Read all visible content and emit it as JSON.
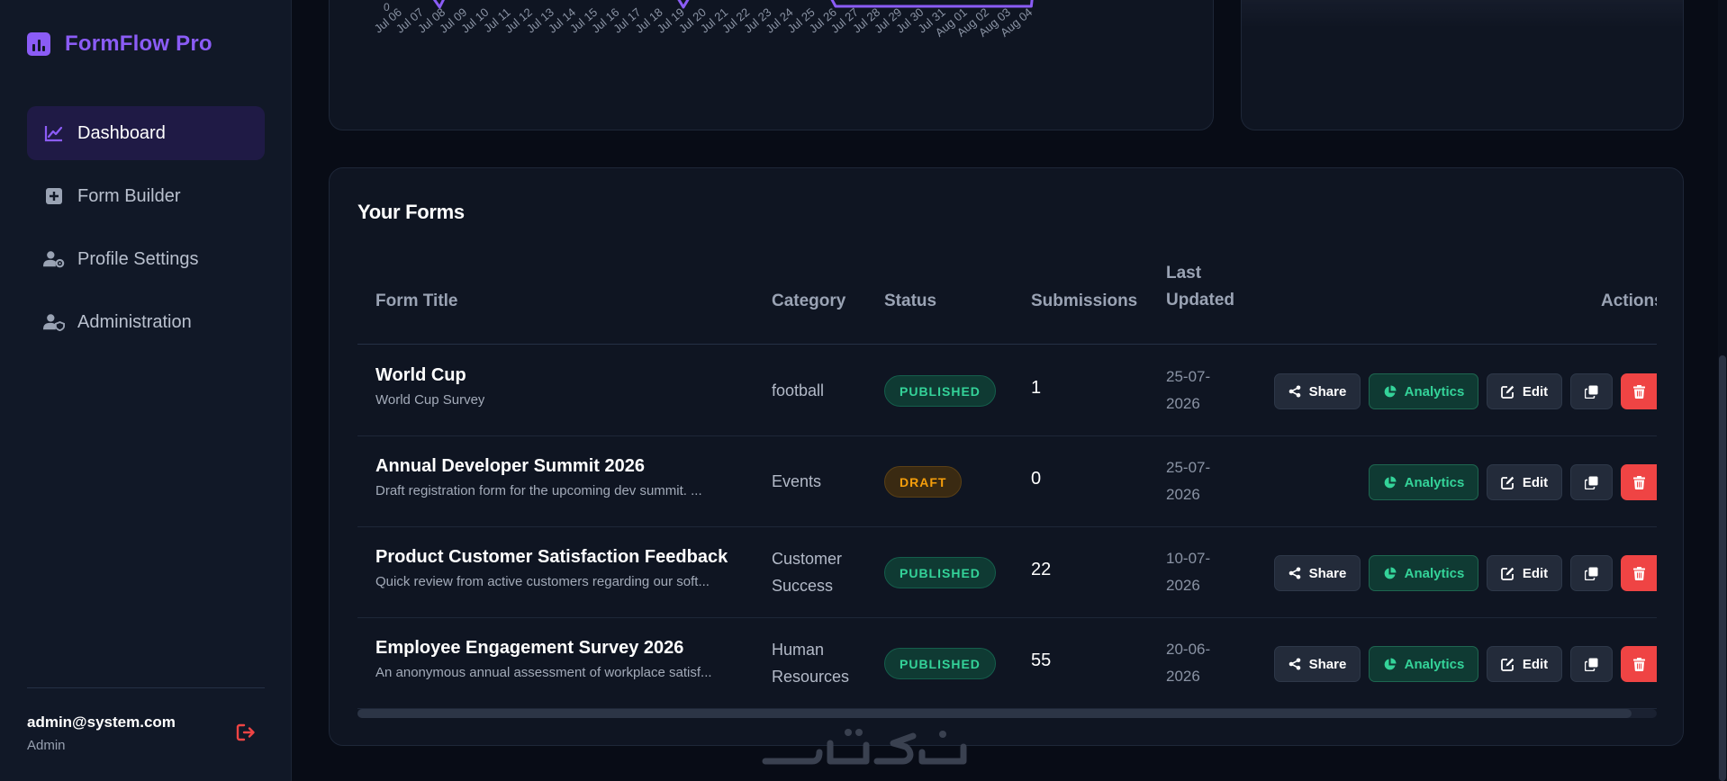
{
  "brand": {
    "name": "FormFlow Pro"
  },
  "nav": {
    "items": [
      {
        "label": "Dashboard",
        "icon": "line-chart-icon",
        "active": true
      },
      {
        "label": "Form Builder",
        "icon": "plus-square-icon",
        "active": false
      },
      {
        "label": "Profile Settings",
        "icon": "user-gear-icon",
        "active": false
      },
      {
        "label": "Administration",
        "icon": "user-shield-icon",
        "active": false
      }
    ]
  },
  "user": {
    "email": "admin@system.com",
    "role": "Admin"
  },
  "chart": {
    "y_tick_zero": "0",
    "x_labels": [
      "Jul 06",
      "Jul 07",
      "Jul 08",
      "Jul 09",
      "Jul 10",
      "Jul 11",
      "Jul 12",
      "Jul 13",
      "Jul 14",
      "Jul 15",
      "Jul 16",
      "Jul 17",
      "Jul 18",
      "Jul 19",
      "Jul 20",
      "Jul 21",
      "Jul 22",
      "Jul 23",
      "Jul 24",
      "Jul 25",
      "Jul 26",
      "Jul 27",
      "Jul 28",
      "Jul 29",
      "Jul 30",
      "Jul 31",
      "Aug 01",
      "Aug 02",
      "Aug 03",
      "Aug 04"
    ],
    "line_color": "#8b5cf6"
  },
  "forms": {
    "title": "Your Forms",
    "columns": {
      "title": "Form Title",
      "category": "Category",
      "status": "Status",
      "submissions": "Submissions",
      "updated_line1": "Last",
      "updated_line2": "Updated",
      "actions": "Actions"
    },
    "actions": {
      "share": "Share",
      "analytics": "Analytics",
      "edit": "Edit"
    },
    "rows": [
      {
        "title": "World Cup",
        "desc": "World Cup Survey",
        "cat1": "football",
        "cat2": "",
        "status": "PUBLISHED",
        "submissions": "1",
        "date1": "25-07-",
        "date2": "2026",
        "share": true
      },
      {
        "title": "Annual Developer Summit 2026",
        "desc": "Draft registration form for the upcoming dev summit. ...",
        "cat1": "Events",
        "cat2": "",
        "status": "DRAFT",
        "submissions": "0",
        "date1": "25-07-",
        "date2": "2026",
        "share": false
      },
      {
        "title": "Product Customer Satisfaction Feedback",
        "desc": "Quick review from active customers regarding our soft...",
        "cat1": "Customer",
        "cat2": "Success",
        "status": "PUBLISHED",
        "submissions": "22",
        "date1": "10-07-",
        "date2": "2026",
        "share": true
      },
      {
        "title": "Employee Engagement Survey 2026",
        "desc": "An anonymous annual assessment of workplace satisf...",
        "cat1": "Human",
        "cat2": "Resources",
        "status": "PUBLISHED",
        "submissions": "55",
        "date1": "20-06-",
        "date2": "2026",
        "share": true
      }
    ]
  },
  "colors": {
    "accent": "#8b5cf6",
    "published": "#34d399",
    "draft": "#f59e0b",
    "danger": "#ef4444",
    "logout": "#ef4444"
  }
}
